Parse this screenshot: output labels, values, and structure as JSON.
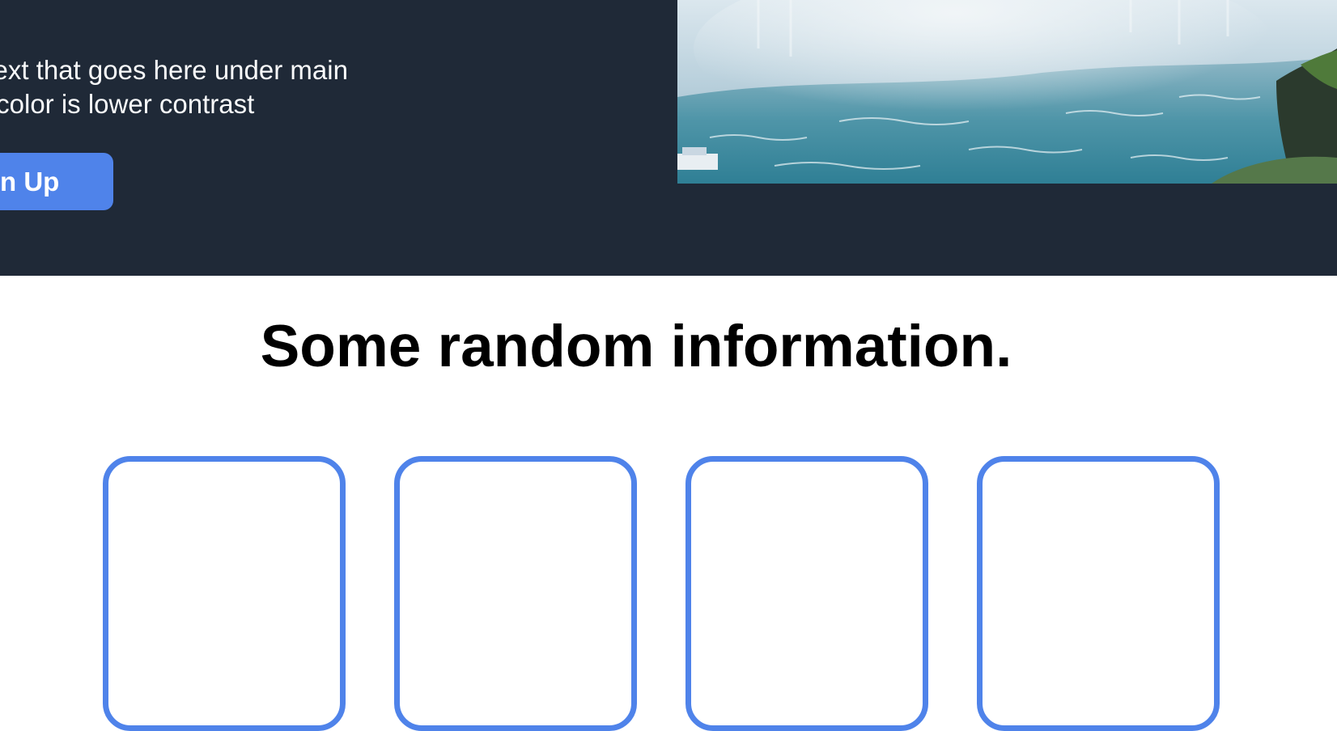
{
  "hero": {
    "subtext_line1": "bsite has some subtext that goes here under main",
    "subtext_line2": " smaller text and the color is lower contrast",
    "signup_label": "n Up",
    "background_color": "#1f2937",
    "accent_color": "#4f83ea"
  },
  "info": {
    "heading": "Some random information.",
    "cards": [
      {
        "label": ""
      },
      {
        "label": ""
      },
      {
        "label": ""
      },
      {
        "label": ""
      }
    ]
  }
}
